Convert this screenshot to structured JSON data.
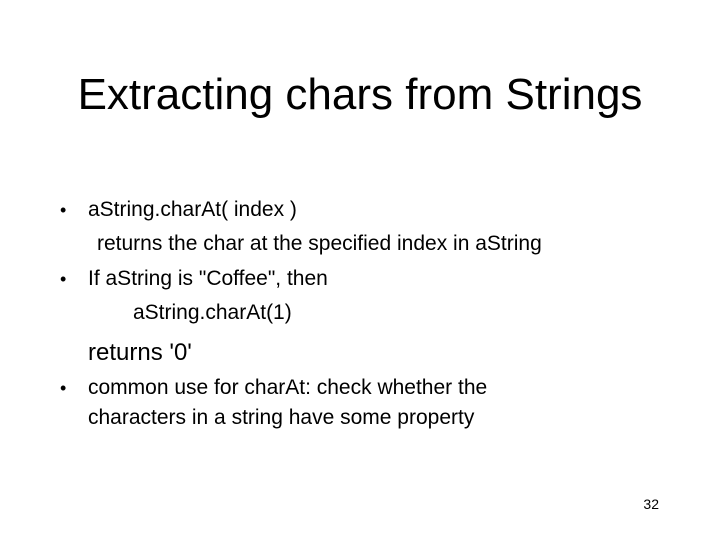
{
  "slide": {
    "title": "Extracting chars from Strings",
    "bullets": [
      {
        "marker": "•",
        "lines": [
          "aString.charAt( index )",
          "returns the char at the specified index in aString"
        ]
      },
      {
        "marker": "•",
        "lines": [
          "If aString is \"Coffee\", then",
          "aString.charAt(1)",
          "returns '0'"
        ]
      },
      {
        "marker": "•",
        "lines": [
          "common use for charAt: check whether the",
          "characters in a string have some property"
        ]
      }
    ],
    "page_number": "32"
  }
}
